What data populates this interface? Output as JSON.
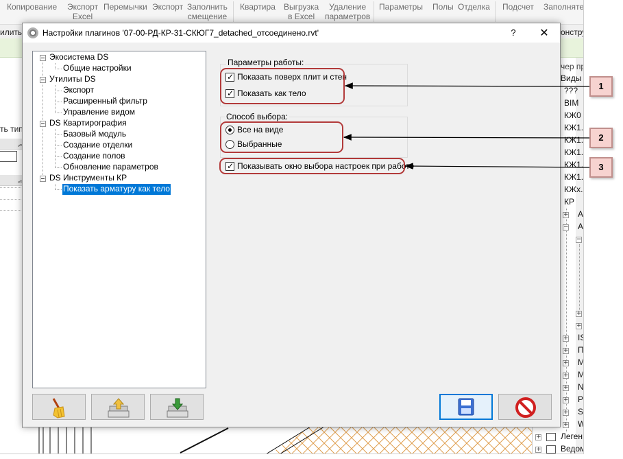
{
  "ribbon": {
    "tabs": [
      {
        "line1": "Копирование",
        "line2": ""
      },
      {
        "line1": "Экспорт",
        "line2": "Excel"
      },
      {
        "line1": "Перемычки",
        "line2": ""
      },
      {
        "line1": "Экспорт",
        "line2": ""
      },
      {
        "line1": "Заполнить",
        "line2": "смещение"
      },
      {
        "line1": "Квартира",
        "line2": ""
      },
      {
        "line1": "Выгрузка",
        "line2": "в Excel"
      },
      {
        "line1": "Удаление",
        "line2": "параметров"
      },
      {
        "line1": "Параметры",
        "line2": ""
      },
      {
        "line1": "Полы",
        "line2": ""
      },
      {
        "line1": "Отделка",
        "line2": ""
      },
      {
        "line1": "Подсчет",
        "line2": ""
      },
      {
        "line1": "Заполняте",
        "line2": ""
      }
    ],
    "row2_left": "илиты",
    "row2_right": "онстру"
  },
  "left_panel": {
    "type_label": "ть тип"
  },
  "project_browser": {
    "title": "чер пр",
    "views_label": "Виды",
    "items": [
      "???",
      "BIM",
      "КЖ0",
      "КЖ1.",
      "КЖ1.",
      "КЖ1.",
      "КЖ1.",
      "КЖ1.",
      "КЖх.",
      "КР"
    ],
    "nodes": [
      "А",
      "А",
      "IS",
      "П",
      "М",
      "М",
      "N",
      "Р",
      "S",
      "W"
    ],
    "legend_label": "Леген",
    "schedules_label": "Ведом"
  },
  "dialog": {
    "title": "Настройки плагинов '07-00-РД-КР-31-СКЮГ7_detached_отсоединено.rvt'",
    "help_label": "?",
    "close_label": "✕",
    "tree": [
      {
        "label": "Экосистема DS",
        "level": 0
      },
      {
        "label": "Общие настройки",
        "level": 1
      },
      {
        "label": "Утилиты DS",
        "level": 0
      },
      {
        "label": "Экспорт",
        "level": 1
      },
      {
        "label": "Расширенный фильтр",
        "level": 1
      },
      {
        "label": "Управление видом",
        "level": 1
      },
      {
        "label": "DS Квартирография",
        "level": 0
      },
      {
        "label": "Базовый модуль",
        "level": 1
      },
      {
        "label": "Создание отделки",
        "level": 1
      },
      {
        "label": "Создание полов",
        "level": 1
      },
      {
        "label": "Обновление параметров",
        "level": 1
      },
      {
        "label": "DS Инструменты КР",
        "level": 0
      },
      {
        "label": "Показать арматуру как тело",
        "level": 1,
        "selected": true
      }
    ],
    "work_params": {
      "legend": "Параметры работы:",
      "show_over_slabs": {
        "label": "Показать поверх плит и стен",
        "checked": true
      },
      "show_as_solid": {
        "label": "Показать как тело",
        "checked": true
      }
    },
    "selection_method": {
      "legend": "Способ выбора:",
      "options": [
        {
          "label": "Все на виде",
          "selected": true
        },
        {
          "label": "Выбранные",
          "selected": false
        }
      ]
    },
    "show_settings_window": {
      "label": "Показывать окно выбора настроек при работе",
      "checked": true
    },
    "buttons": {
      "clean": "broom-icon",
      "load": "folder-upload-icon",
      "save_file": "folder-download-icon",
      "save": "floppy-disk-icon",
      "cancel": "cancel-icon"
    }
  },
  "callouts": [
    "1",
    "2",
    "3"
  ],
  "colors": {
    "annotation_red": "#b23a3a",
    "callout_fill": "#f7d3d0",
    "selection_blue": "#0078d7"
  }
}
